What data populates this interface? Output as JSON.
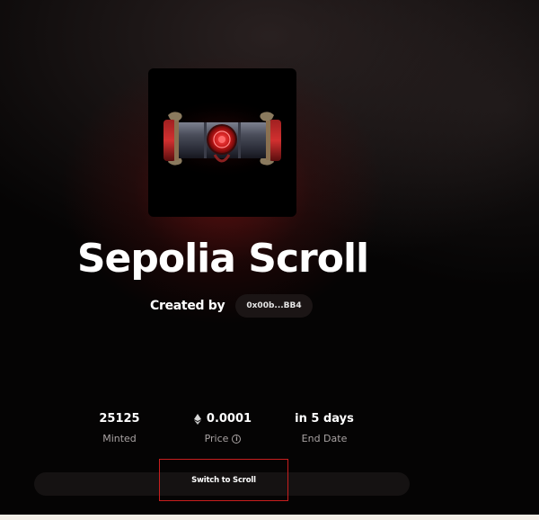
{
  "collection": {
    "title": "Sepolia Scroll",
    "created_by_label": "Created by",
    "creator_address": "0x00b...BB4"
  },
  "stats": [
    {
      "value": "25125",
      "label": "Minted"
    },
    {
      "value": "0.0001",
      "label": "Price",
      "icon": "ethereum-icon"
    },
    {
      "value": "in 5 days",
      "label": "End Date"
    }
  ],
  "actions": {
    "switch_label": "Switch to Scroll"
  },
  "colors": {
    "background": "#050404",
    "accent_red": "#c81e1e",
    "chip_bg": "#1b1515",
    "muted_text": "#a9a3a3"
  }
}
